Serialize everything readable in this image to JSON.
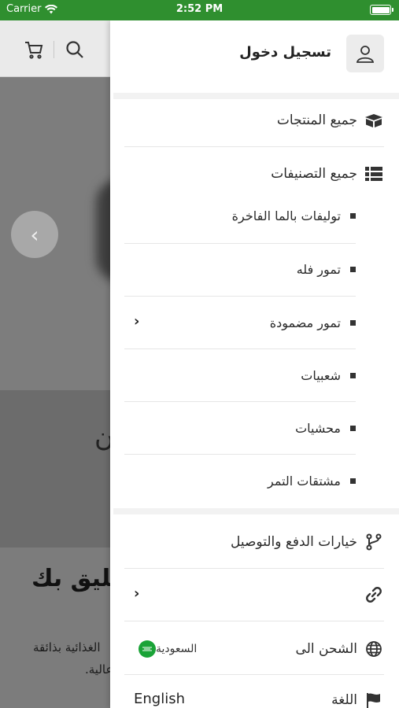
{
  "status": {
    "carrier": "Carrier",
    "time": "2:52 PM"
  },
  "background": {
    "prev_glyph": "‹",
    "mid_glyph": "ن",
    "heading": "تليق بك",
    "line1": "الغذائية بذائقة",
    "line2": "عالية."
  },
  "drawer": {
    "login_label": "تسجيل دخول",
    "all_products": "جميع المنتجات",
    "all_categories": "جميع التصنيفات",
    "categories": [
      {
        "label": "توليفات بالما الفاخرة",
        "has_children": false
      },
      {
        "label": "تمور فله",
        "has_children": false
      },
      {
        "label": "تمور مضمودة",
        "has_children": true
      },
      {
        "label": "شعبيات",
        "has_children": false
      },
      {
        "label": "محشيات",
        "has_children": false
      },
      {
        "label": "مشتقات التمر",
        "has_children": false
      }
    ],
    "payment_shipping": "خيارات الدفع والتوصيل",
    "shipping_to": "الشحن الى",
    "shipping_country": "السعودية",
    "language_label": "اللغة",
    "language_value": "English",
    "chevron": "›"
  },
  "icons": {
    "cart": "cart-icon",
    "search": "search-icon",
    "user": "user-icon",
    "products": "box-icon",
    "categories": "list-icon",
    "payment": "branch-icon",
    "link": "link-icon",
    "globe": "globe-icon",
    "flag": "flag-icon"
  },
  "colors": {
    "status_bar": "#2f8f2f",
    "flag_green": "#1aa337"
  }
}
